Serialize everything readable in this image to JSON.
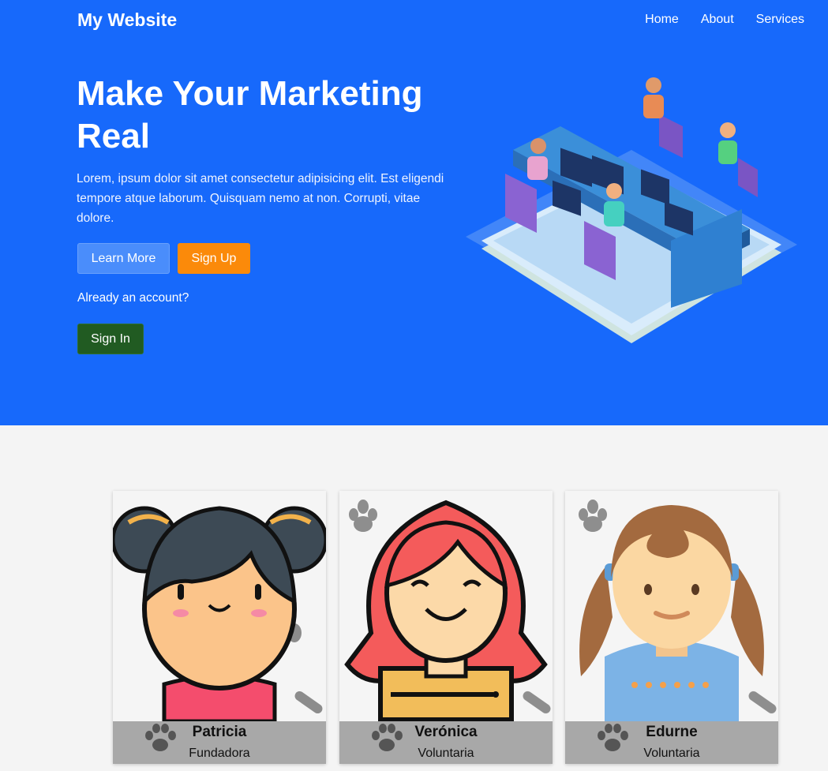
{
  "header": {
    "brand": "My Website",
    "nav": [
      "Home",
      "About",
      "Services"
    ]
  },
  "hero": {
    "title": "Make Your Marketing Real",
    "lead": "Lorem, ipsum dolor sit amet consectetur adipisicing elit. Est eligendi tempore atque laborum. Quisquam nemo at non. Corrupti, vitae dolore.",
    "learn_more": "Learn More",
    "sign_up": "Sign Up",
    "already": "Already an account?",
    "sign_in": "Sign In"
  },
  "team": [
    {
      "name": "Patricia",
      "role": "Fundadora"
    },
    {
      "name": "Verónica",
      "role": "Voluntaria"
    },
    {
      "name": "Edurne",
      "role": "Voluntaria"
    }
  ],
  "colors": {
    "hero_bg": "#1769fb",
    "learn_more_bg": "#4a8dfb",
    "sign_up_bg": "#fb8a0a",
    "sign_in_bg": "#215b22",
    "page_bg": "#f4f4f4",
    "caption_bg": "#a8a8a8"
  }
}
